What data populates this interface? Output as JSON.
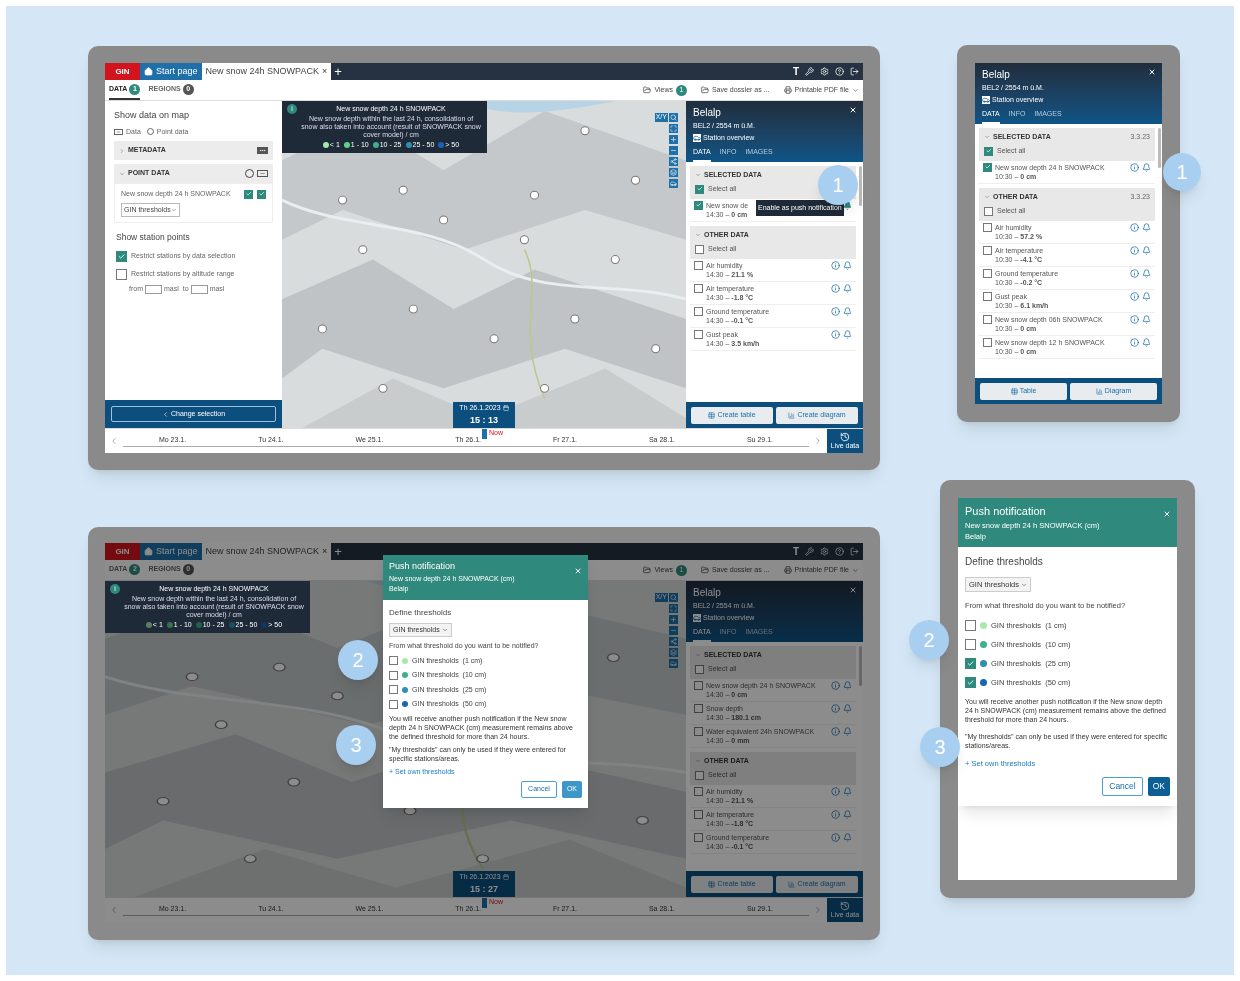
{
  "desktop_screen": {
    "header": {
      "logo": "GIN",
      "home_tab": "Start page",
      "doc_tab": "New snow 24h SNOWPACK",
      "close_glyph": "×",
      "add_glyph": "+",
      "text_tool": "T"
    },
    "tabs": [
      {
        "label": "DATA",
        "count": "1",
        "selected": true
      },
      {
        "label": "REGIONS",
        "count": "0",
        "selected": false
      }
    ],
    "actions": [
      {
        "label": "Views",
        "count": "1"
      },
      {
        "label": "Save dossier as ..."
      },
      {
        "label": "Printable PDF file"
      }
    ],
    "sidebar": {
      "title": "Show data on map",
      "modes": [
        "Data",
        "Point data"
      ],
      "sections": [
        {
          "title": "METADATA",
          "expanded": false
        },
        {
          "title": "POINT DATA",
          "expanded": true,
          "layer": "New snow depth 24 h SNOWPACK",
          "toggles": [
            true,
            true
          ],
          "dropdown": "GIN thresholds"
        }
      ],
      "stations_title": "Show station points",
      "options": [
        {
          "label": "Restrict stations by data selection",
          "checked": true
        },
        {
          "label": "Restrict stations by altitude range",
          "checked": false
        }
      ],
      "altitude": [
        "from",
        "masl",
        "to",
        "masl"
      ],
      "button": "Change selection"
    },
    "legend": {
      "badge": "i",
      "title": "New snow depth 24 h SNOWPACK",
      "description": "New snow depth within the last 24 h, consolidation of snow also taken into account (result of SNOWPACK snow cover model) / cm",
      "classes": [
        {
          "label": "< 1",
          "color": "#a6e9a9"
        },
        {
          "label": "1 - 10",
          "color": "#5fd18a"
        },
        {
          "label": "10 - 25",
          "color": "#3fb08a"
        },
        {
          "label": "25 - 50",
          "color": "#2f8fb0"
        },
        {
          "label": "> 50",
          "color": "#1565b8"
        }
      ]
    },
    "map_controls_label": "X/Y",
    "panel": {
      "name": "Belalp",
      "subtitle": "BEL2 / 2554 m ü.M.",
      "link": "Station overview",
      "tabs": [
        {
          "label": "DATA",
          "selected": true
        },
        {
          "label": "INFO",
          "selected": false
        },
        {
          "label": "IMAGES",
          "selected": false
        }
      ],
      "groups": [
        {
          "title": "SELECTED DATA",
          "select_all": {
            "label": "Select all",
            "checked": true
          },
          "items": [
            {
              "name": "New snow de",
              "reading": "14:30 – **0 cm**",
              "checked": true,
              "notify": true,
              "tooltip": "Enable as push notification"
            }
          ]
        },
        {
          "title": "OTHER DATA",
          "select_all": {
            "label": "Select all",
            "checked": false
          },
          "items": [
            {
              "name": "Air humidity",
              "reading": "14:30 – **21.1 %**",
              "checked": false,
              "notify": false
            },
            {
              "name": "Air temperature",
              "reading": "14:30 – **-1.8 °C**",
              "checked": false,
              "notify": false
            },
            {
              "name": "Ground temperature",
              "reading": "14:30 – **-0.1 °C**",
              "checked": false,
              "notify": false
            },
            {
              "name": "Gust peak",
              "reading": "14:30 – **3.5 km/h**",
              "checked": false,
              "notify": false
            }
          ]
        }
      ],
      "buttons": [
        "Create table",
        "Create diagram"
      ]
    },
    "timeline": {
      "days": [
        "Mo 23.1.",
        "Tu 24.1.",
        "We 25.1.",
        "Th 26.1.",
        "Fr 27.1.",
        "Sa 28.1.",
        "Su 29.1."
      ],
      "date": "Th 26.1.2023",
      "time": "15 : 13",
      "now_label": "Now",
      "live_label": "Live data"
    }
  },
  "station_phone": {
    "name": "Belalp",
    "subtitle": "BEL2 / 2554 m ü.M.",
    "link": "Station overview",
    "tabs": [
      {
        "label": "DATA",
        "selected": true
      },
      {
        "label": "INFO",
        "selected": false
      },
      {
        "label": "IMAGES",
        "selected": false
      }
    ],
    "groups": [
      {
        "title": "SELECTED DATA",
        "date": "3.3.23",
        "select_all": {
          "label": "Select all",
          "checked": true
        },
        "items": [
          {
            "name": "New snow depth 24 h SNOWPACK",
            "reading": "10:30 – **0 cm**",
            "checked": true,
            "notify": false
          }
        ]
      },
      {
        "title": "OTHER DATA",
        "date": "3.3.23",
        "select_all": {
          "label": "Select all",
          "checked": false
        },
        "items": [
          {
            "name": "Air humidity",
            "reading": "10:30 – **57.2 %**",
            "checked": false,
            "notify": false
          },
          {
            "name": "Air temperature",
            "reading": "10:30 – **-4.1 °C**",
            "checked": false,
            "notify": false
          },
          {
            "name": "Ground temperature",
            "reading": "10:30 – **-0.2 °C**",
            "checked": false,
            "notify": false
          },
          {
            "name": "Gust peak",
            "reading": "10:30 – **6.1 km/h**",
            "checked": false,
            "notify": false
          },
          {
            "name": "New snow depth 06h SNOWPACK",
            "reading": "10:30 – **0 cm**",
            "checked": false,
            "notify": false
          },
          {
            "name": "New snow depth 12 h SNOWPACK",
            "reading": "10:30 – **0 cm**",
            "checked": false,
            "notify": false
          }
        ]
      }
    ],
    "buttons": [
      "Table",
      "Diagram"
    ]
  },
  "dialog_screen": {
    "header": {
      "logo": "GIN",
      "home_tab": "Start page",
      "doc_tab": "New snow 24h SNOWPACK",
      "close_glyph": "×",
      "add_glyph": "+",
      "text_tool": "T"
    },
    "tabs": [
      {
        "label": "DATA",
        "count": "2",
        "selected": false
      },
      {
        "label": "REGIONS",
        "count": "0",
        "selected": false
      }
    ],
    "actions": [
      {
        "label": "Views",
        "count": "1"
      },
      {
        "label": "Save dossier as ..."
      },
      {
        "label": "Printable PDF file"
      }
    ],
    "legend": {
      "badge": "i",
      "title": "New snow depth 24 h SNOWPACK",
      "description": "New snow depth within the last 24 h, consolidation of snow also taken into account (result of SNOWPACK snow cover model) / cm",
      "classes": [
        {
          "label": "< 1",
          "color": "#5b805d"
        },
        {
          "label": "1 - 10",
          "color": "#34734c"
        },
        {
          "label": "10 - 25",
          "color": "#23614c"
        },
        {
          "label": "25 - 50",
          "color": "#1a4f61"
        },
        {
          "label": "> 50",
          "color": "#0c3865"
        }
      ]
    },
    "map_controls_label": "X/Y",
    "panel": {
      "name": "Belalp",
      "subtitle": "BEL2 / 2554 m ü.M.",
      "link": "Station overview",
      "tabs": [
        {
          "label": "DATA",
          "selected": true
        },
        {
          "label": "INFO",
          "selected": false
        },
        {
          "label": "IMAGES",
          "selected": false
        }
      ],
      "groups": [
        {
          "title": "SELECTED DATA",
          "select_all": {
            "label": "Select all",
            "checked": false
          },
          "items": [
            {
              "name": "New snow depth 24 h SNOWPACK",
              "reading": "14:30 – **0 cm**",
              "checked": false,
              "notify": false
            },
            {
              "name": "Snow depth",
              "reading": "14:30 – **180.1 cm**",
              "checked": false,
              "notify": false
            },
            {
              "name": "Water equivalent 24h SNOWPACK",
              "reading": "14:30 – **0 mm**",
              "checked": false,
              "notify": false
            }
          ]
        },
        {
          "title": "OTHER DATA",
          "select_all": {
            "label": "Select all",
            "checked": false
          },
          "items": [
            {
              "name": "Air humidity",
              "reading": "14:30 – **21.1 %**",
              "checked": false,
              "notify": false
            },
            {
              "name": "Air temperature",
              "reading": "14:30 – **-1.8 °C**",
              "checked": false,
              "notify": false
            },
            {
              "name": "Ground temperature",
              "reading": "14:30 – **-0.1 °C**",
              "checked": false,
              "notify": false
            }
          ]
        }
      ],
      "buttons": [
        "Create table",
        "Create diagram"
      ]
    },
    "timeline": {
      "days": [
        "Mo 23.1.",
        "Tu 24.1.",
        "We 25.1.",
        "Th 26.1.",
        "Fr 27.1.",
        "Sa 28.1.",
        "Su 29.1."
      ],
      "date": "Th 26.1.2023",
      "time": "15 : 27",
      "now_label": "Now",
      "live_label": "Live data"
    },
    "dialog": {
      "title": "Push notification",
      "subtitle": "New snow depth 24 h SNOWPACK (cm)",
      "station": "Belalp",
      "section": "Define thresholds",
      "dropdown": "GIN thresholds",
      "question": "From what threshold do you want to be notified?",
      "options": [
        {
          "label": "GIN thresholds  (1 cm)",
          "color": "#a6e9a9",
          "checked": false
        },
        {
          "label": "GIN thresholds  (10 cm)",
          "color": "#3fb08a",
          "checked": false
        },
        {
          "label": "GIN thresholds  (25 cm)",
          "color": "#2f8fb0",
          "checked": false
        },
        {
          "label": "GIN thresholds  (50 cm)",
          "color": "#1565b8",
          "checked": false
        }
      ],
      "notes": [
        "You will receive another push notification if the New snow depth 24 h SNOWPACK (cm) measurement remains above the defined threshold for more than 24 hours.",
        "\"My thresholds\" can only be used if they were entered for specific stations/areas."
      ],
      "link": "+ Set own thresholds",
      "buttons": [
        "Cancel",
        "OK"
      ]
    }
  },
  "dialog_phone": {
    "title": "Push notification",
    "subtitle": "New snow depth 24 h SNOWPACK (cm)",
    "station": "Belalp",
    "section": "Define thresholds",
    "dropdown": "GIN thresholds",
    "question": "From what threshold do you want to be notified?",
    "options": [
      {
        "label": "GIN thresholds  (1 cm)",
        "color": "#a6e9a9",
        "checked": false
      },
      {
        "label": "GIN thresholds  (10 cm)",
        "color": "#3fb08a",
        "checked": false
      },
      {
        "label": "GIN thresholds  (25 cm)",
        "color": "#2f8fb0",
        "checked": true
      },
      {
        "label": "GIN thresholds  (50 cm)",
        "color": "#1565b8",
        "checked": true
      }
    ],
    "notes": [
      "You will receive another push notification if the New snow depth 24 h SNOWPACK (cm) measurement remains above the defined threshold for more than 24 hours.",
      "\"My thresholds\" can only be used if they were entered for specific stations/areas."
    ],
    "link": "+ Set own thresholds",
    "buttons": [
      "Cancel",
      "OK"
    ]
  },
  "callouts": [
    "1",
    "1",
    "2",
    "3",
    "2",
    "3"
  ]
}
